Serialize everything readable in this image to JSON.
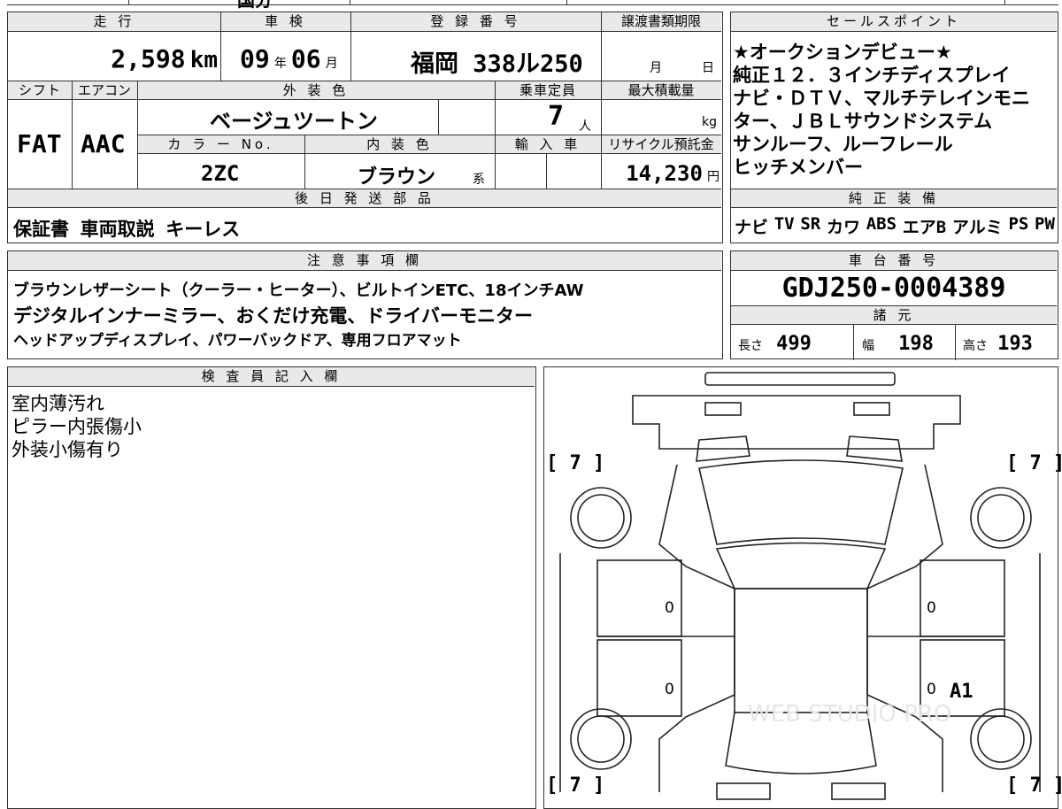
{
  "top_strip": {
    "partial_text": "国分"
  },
  "table1": {
    "headers": {
      "mileage": "走 行",
      "inspection": "車 検",
      "registration": "登 録 番 号",
      "transfer_deadline": "譲渡書類期限"
    },
    "mileage_value": "2,598",
    "mileage_unit": "km",
    "inspection_year": "09",
    "year_unit": "年",
    "inspection_month": "06",
    "month_unit": "月",
    "registration_number": "福岡 338ル250",
    "transfer_month_unit": "月",
    "transfer_day_unit": "日",
    "headers2": {
      "shift": "シフト",
      "aircon": "エアコン",
      "exterior_color": "外 装 色",
      "capacity": "乗車定員",
      "max_load": "最大積載量"
    },
    "shift_value": "FAT",
    "aircon_value": "AAC",
    "exterior_color_value": "ベージュツートン",
    "capacity_value": "7",
    "capacity_unit": "人",
    "max_load_unit": "kg",
    "headers3": {
      "color_no": "カ ラ ー No.",
      "interior_color": "内 装 色",
      "import": "輸 入 車",
      "recycle": "リサイクル預託金"
    },
    "color_no_value": "2ZC",
    "interior_color_value": "ブラウン",
    "interior_color_suffix": "系",
    "recycle_value": "14,230",
    "recycle_unit": "円",
    "later_parts_header": "後 日 発 送 部 品",
    "later_parts_value": "保証書 車両取説 キーレス"
  },
  "sales_points": {
    "header": "セールスポイント",
    "lines": [
      "★オークションデビュー★",
      "純正１２．３インチディスプレイ",
      "ナビ・ＤＴＶ、マルチテレインモニ",
      "ター、ＪＢＬサウンドシステム",
      "サンルーフ、ルーフレール",
      "ヒッチメンバー"
    ]
  },
  "equipment": {
    "header": "純 正 装 備",
    "items": [
      "ナビ",
      "TV",
      "SR",
      "カワ",
      "ABS",
      "エアB",
      "アルミ",
      "PS",
      "PW"
    ]
  },
  "notes": {
    "header": "注 意 事 項 欄",
    "lines": [
      "ブラウンレザーシート（クーラー・ヒーター）、ビルトインETC、18インチAW",
      "デジタルインナーミラー、おくだけ充電、ドライバーモニター",
      "ヘッドアップディスプレイ、パワーバックドア、専用フロアマット"
    ]
  },
  "chassis": {
    "header": "車 台 番 号",
    "value": "GDJ250-0004389",
    "spec_header": "諸 元",
    "length_label": "長さ",
    "length_value": "499",
    "width_label": "幅",
    "width_value": "198",
    "height_label": "高さ",
    "height_value": "193"
  },
  "inspector": {
    "header": "検 査 員 記 入 欄",
    "lines": [
      "室内薄汚れ",
      "ピラー内張傷小",
      "外装小傷有り"
    ]
  },
  "diagram": {
    "corner_fl": "[ 7 ]",
    "corner_fr": "[ 7 ]",
    "corner_rl": "[ 7 ]",
    "corner_rr": "[ 7 ]",
    "left_front_door": "0",
    "left_rear_door": "0",
    "right_front_door": "0",
    "right_rear_door": "0",
    "damage_code": "A1",
    "watermark": "WEB STUDIO PRO"
  }
}
